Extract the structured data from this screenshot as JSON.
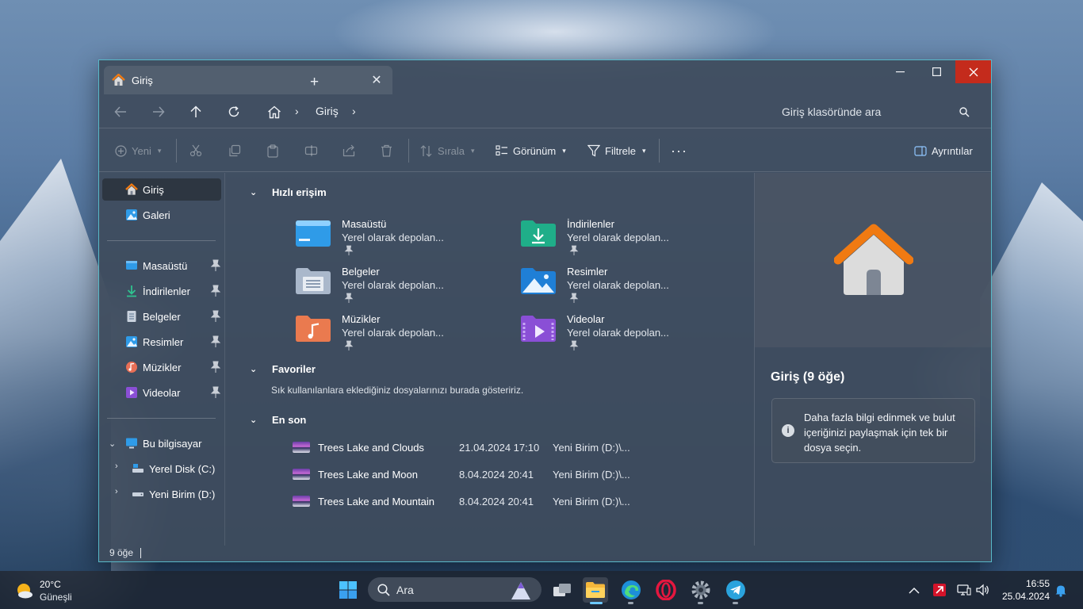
{
  "window": {
    "tab_title": "Giriş",
    "path": "Giriş",
    "search_placeholder": "Giriş klasöründe ara"
  },
  "toolbar": {
    "new": "Yeni",
    "sort": "Sırala",
    "view": "Görünüm",
    "filter": "Filtrele",
    "details": "Ayrıntılar"
  },
  "sidebar": {
    "top_items": [
      {
        "label": "Giriş",
        "icon": "home-icon"
      },
      {
        "label": "Galeri",
        "icon": "gallery-icon"
      }
    ],
    "pinned": [
      {
        "label": "Masaüstü",
        "icon": "desktop-icon"
      },
      {
        "label": "İndirilenler",
        "icon": "downloads-icon"
      },
      {
        "label": "Belgeler",
        "icon": "documents-icon"
      },
      {
        "label": "Resimler",
        "icon": "pictures-icon"
      },
      {
        "label": "Müzikler",
        "icon": "music-icon"
      },
      {
        "label": "Videolar",
        "icon": "videos-icon"
      }
    ],
    "this_pc": "Bu bilgisayar",
    "drives": [
      {
        "label": "Yerel Disk (C:)",
        "icon": "drive-c-icon"
      },
      {
        "label": "Yeni Birim (D:)",
        "icon": "drive-d-icon"
      }
    ]
  },
  "content": {
    "quick_access_title": "Hızlı erişim",
    "quick_access": [
      {
        "name": "Masaüstü",
        "sub": "Yerel olarak depolan..."
      },
      {
        "name": "İndirilenler",
        "sub": "Yerel olarak depolan..."
      },
      {
        "name": "Belgeler",
        "sub": "Yerel olarak depolan..."
      },
      {
        "name": "Resimler",
        "sub": "Yerel olarak depolan..."
      },
      {
        "name": "Müzikler",
        "sub": "Yerel olarak depolan..."
      },
      {
        "name": "Videolar",
        "sub": "Yerel olarak depolan..."
      }
    ],
    "favorites_title": "Favoriler",
    "favorites_hint": "Sık kullanılanlara eklediğiniz dosyalarınızı burada gösteririz.",
    "recent_title": "En son",
    "recent": [
      {
        "name": "Trees Lake and Clouds",
        "date": "21.04.2024 17:10",
        "location": "Yeni Birim (D:)\\..."
      },
      {
        "name": "Trees Lake and Moon",
        "date": "8.04.2024 20:41",
        "location": "Yeni Birim (D:)\\..."
      },
      {
        "name": "Trees Lake and Mountain",
        "date": "8.04.2024 20:41",
        "location": "Yeni Birim (D:)\\..."
      }
    ]
  },
  "details_pane": {
    "title": "Giriş (9 öğe)",
    "info": "Daha fazla bilgi edinmek ve bulut içeriğinizi paylaşmak için tek bir dosya seçin."
  },
  "status": {
    "count": "9 öğe"
  },
  "taskbar": {
    "temperature": "20°C",
    "condition": "Güneşli",
    "search_label": "Ara",
    "time": "16:55",
    "date": "25.04.2024"
  },
  "colors": {
    "accent": "#58b9c9",
    "close_red": "#c42b1c",
    "folder_blue": "#2f9be8",
    "home_orange": "#f07a12"
  }
}
